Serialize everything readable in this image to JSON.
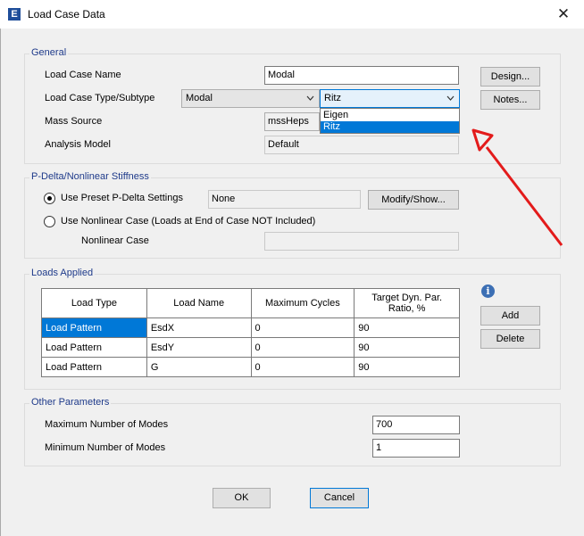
{
  "window": {
    "title": "Load Case Data",
    "app_icon_letter": "E",
    "close_glyph": "✕"
  },
  "general": {
    "title": "General",
    "case_name_label": "Load Case Name",
    "case_name_value": "Modal",
    "type_label": "Load Case Type/Subtype",
    "type_value": "Modal",
    "subtype_value": "Ritz",
    "subtype_options": [
      "Eigen",
      "Ritz"
    ],
    "mass_label": "Mass Source",
    "mass_value": "mssHeps",
    "model_label": "Analysis Model",
    "model_value": "Default",
    "design_button": "Design...",
    "notes_button": "Notes..."
  },
  "pdelta": {
    "title": "P-Delta/Nonlinear Stiffness",
    "preset_label": "Use Preset P-Delta Settings",
    "preset_value": "None",
    "modify_button": "Modify/Show...",
    "nonlinear_label": "Use Nonlinear Case  (Loads at End of Case NOT Included)",
    "nonlinear_case_label": "Nonlinear Case",
    "nonlinear_case_value": ""
  },
  "loads": {
    "title": "Loads Applied",
    "columns": [
      "Load Type",
      "Load Name",
      "Maximum Cycles",
      "Target Dyn. Par. Ratio, %"
    ],
    "rows": [
      [
        "Load Pattern",
        "EsdX",
        "0",
        "90"
      ],
      [
        "Load Pattern",
        "EsdY",
        "0",
        "90"
      ],
      [
        "Load Pattern",
        "G",
        "0",
        "90"
      ]
    ],
    "info_glyph": "i",
    "add_button": "Add",
    "delete_button": "Delete"
  },
  "other": {
    "title": "Other Parameters",
    "max_modes_label": "Maximum Number of Modes",
    "max_modes_value": "700",
    "min_modes_label": "Minimum Number of Modes",
    "min_modes_value": "1"
  },
  "footer": {
    "ok_button": "OK",
    "cancel_button": "Cancel"
  },
  "colors": {
    "accent": "#0078d7",
    "group_title": "#1e3a8a",
    "annotation_arrow": "#e31b1b"
  }
}
